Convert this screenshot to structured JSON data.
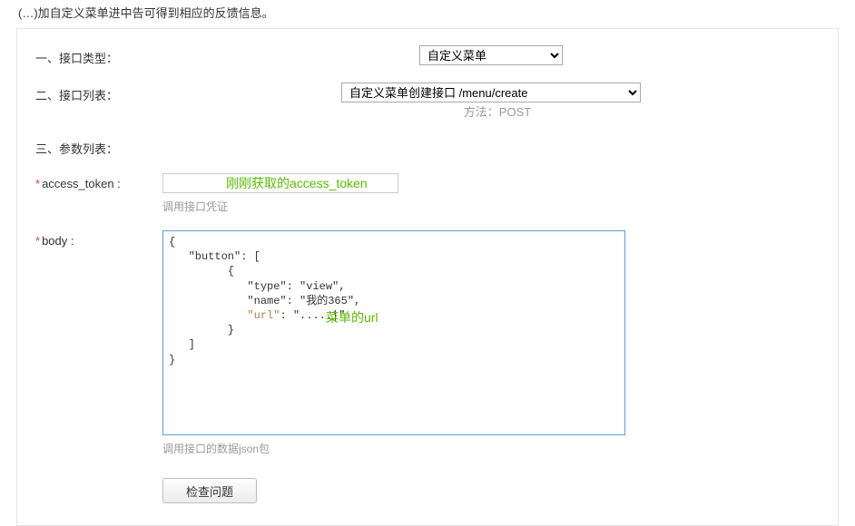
{
  "header": {
    "partial_text": "(…)加自定义菜单进中告可得到相应的反馈信息。"
  },
  "form": {
    "type": {
      "label": "一、接口类型：",
      "selected": "自定义菜单"
    },
    "api_list": {
      "label": "二、接口列表：",
      "selected": "自定义菜单创建接口 /menu/create",
      "method_prefix": "方法：",
      "method": "POST"
    },
    "params_header": {
      "label": "三、参数列表："
    },
    "access_token": {
      "required": "*",
      "label": "access_token :",
      "value": "",
      "desc": "调用接口凭证",
      "annotation": "刚刚获取的access_token"
    },
    "body": {
      "required": "*",
      "label": "body :",
      "desc": "调用接口的数据json包",
      "annotation": "菜单的url",
      "content": "{\n   \"button\": [\n         {\n            \"type\": \"view\",\n            \"name\": \"我的365\",\n            \"url\": \".....|\"\n         }\n   ]\n}"
    },
    "submit": {
      "label": "检查问题"
    }
  }
}
